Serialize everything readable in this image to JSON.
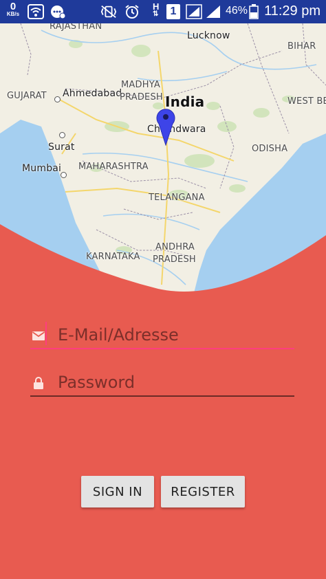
{
  "status_bar": {
    "net_speed": "0",
    "net_unit": "KB/s",
    "network_type": "H",
    "sim_slot": "1",
    "battery": "46%",
    "time": "11:29 pm"
  },
  "map": {
    "labels": {
      "rajasthan": "RAJASTHAN",
      "lucknow": "Lucknow",
      "bihar": "BIHAR",
      "gujarat": "GUJARAT",
      "ahmedabad": "Ahmedabad",
      "madhya": "MADHYA",
      "pradesh_mp": "PRADESH",
      "india": "India",
      "west_be": "WEST BE",
      "chhindwara": "Chhindwara",
      "surat": "Surat",
      "odisha": "ODISHA",
      "mumbai": "Mumbai",
      "maharashtra": "MAHARASHTRA",
      "telangana": "TELANGANA",
      "karnataka": "KARNATAKA",
      "andhra": "ANDHRA",
      "pradesh_ap": "PRADESH"
    }
  },
  "form": {
    "email_placeholder": "E-Mail/Adresse",
    "password_placeholder": "Password",
    "sign_in_label": "SIGN IN",
    "register_label": "REGISTER"
  },
  "colors": {
    "background": "#e85b50",
    "status_bar": "#1f3a9a",
    "email_underline": "#ff3d7f",
    "password_underline": "#6b2a26",
    "button_bg": "#e3e3e3"
  }
}
